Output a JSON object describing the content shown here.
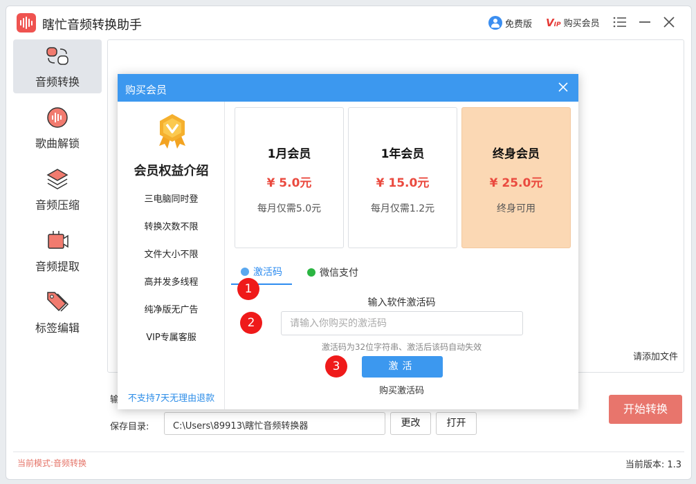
{
  "app": {
    "title": "瞎忙音频转换助手"
  },
  "titlebar": {
    "free_label": "免费版",
    "vip_label": "购买会员"
  },
  "sidebar": {
    "items": [
      {
        "label": "音频转换",
        "icon": "audio-convert-icon"
      },
      {
        "label": "歌曲解锁",
        "icon": "song-unlock-icon"
      },
      {
        "label": "音频压缩",
        "icon": "audio-compress-icon"
      },
      {
        "label": "音频提取",
        "icon": "audio-extract-icon"
      },
      {
        "label": "标签编辑",
        "icon": "tag-edit-icon"
      }
    ]
  },
  "main": {
    "add_file_hint": "请添加文件"
  },
  "output": {
    "label_partial": "输"
  },
  "save": {
    "label": "保存目录:",
    "path": "C:\\Users\\89913\\瞎忙音频转换器",
    "change_label": "更改",
    "open_label": "打开"
  },
  "start_button": "开始转换",
  "status": {
    "mode": "当前模式:音频转换",
    "version": "当前版本: 1.3"
  },
  "dialog": {
    "title": "购买会员",
    "benefits_title": "会员权益介绍",
    "benefits": [
      "三电脑同时登",
      "转换次数不限",
      "文件大小不限",
      "高并发多线程",
      "纯净版无广告",
      "VIP专属客服"
    ],
    "refund_note": "不支持7天无理由退款",
    "plans": [
      {
        "name": "1月会员",
        "price": "¥ 5.0元",
        "desc": "每月仅需5.0元"
      },
      {
        "name": "1年会员",
        "price": "¥ 15.0元",
        "desc": "每月仅需1.2元"
      },
      {
        "name": "终身会员",
        "price": "¥ 25.0元",
        "desc": "终身可用"
      }
    ],
    "tabs": {
      "code": "激活码",
      "wechat": "微信支付"
    },
    "steps": [
      "1",
      "2",
      "3"
    ],
    "code_title": "输入软件激活码",
    "code_placeholder": "请输入你购买的激活码",
    "code_value": "",
    "code_hint": "激活码为32位字符串、激活后该码自动失效",
    "activate_label": "激活",
    "buy_code_label": "购买激活码"
  },
  "colors": {
    "accent": "#3c98ef",
    "price": "#ea4a3f",
    "selected_plan": "#fbd8b4",
    "start": "#e8756c",
    "step": "#ef1a1a"
  }
}
